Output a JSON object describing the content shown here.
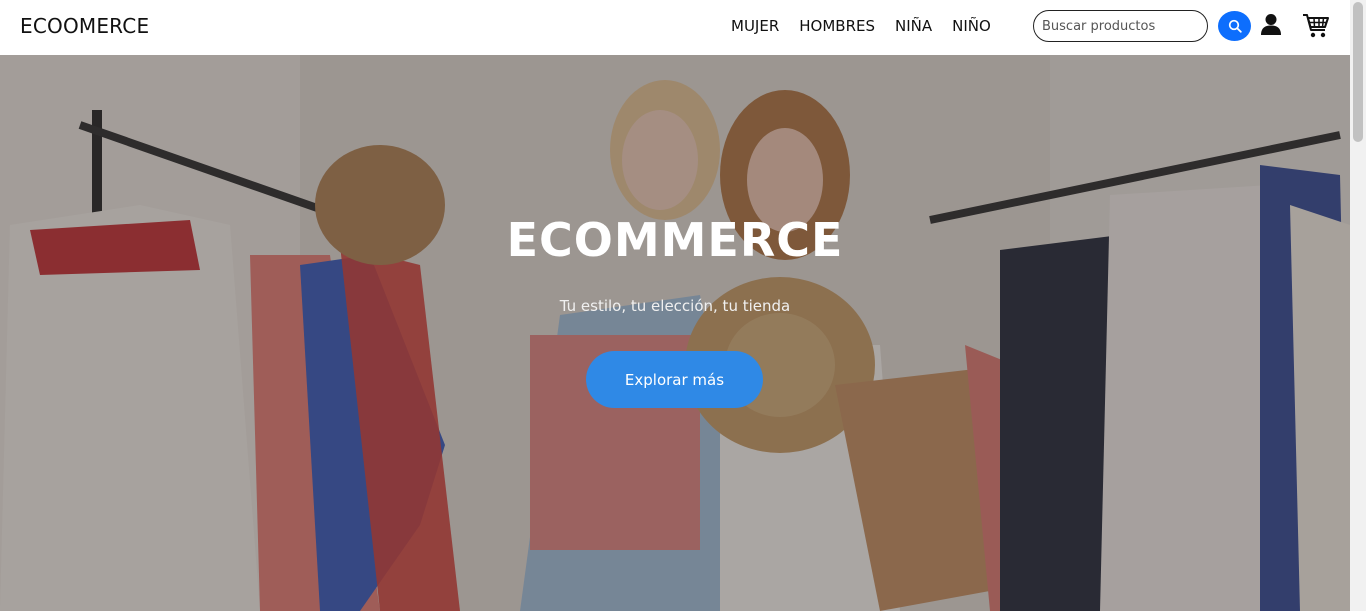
{
  "navbar": {
    "brand": "ECOOMERCE",
    "links": [
      "MUJER",
      "HOMBRES",
      "NIÑA",
      "NIÑO"
    ],
    "search_placeholder": "Buscar productos",
    "search_value": "",
    "icons": [
      "search-icon",
      "user-icon",
      "cart-icon"
    ]
  },
  "hero": {
    "title": "ECOMMERCE",
    "subtitle": "Tu estilo, tu elección, tu tienda",
    "cta_label": "Explorar más"
  },
  "colors": {
    "accent": "#0d6efd",
    "cta": "#2f89e6",
    "text": "#111111"
  }
}
